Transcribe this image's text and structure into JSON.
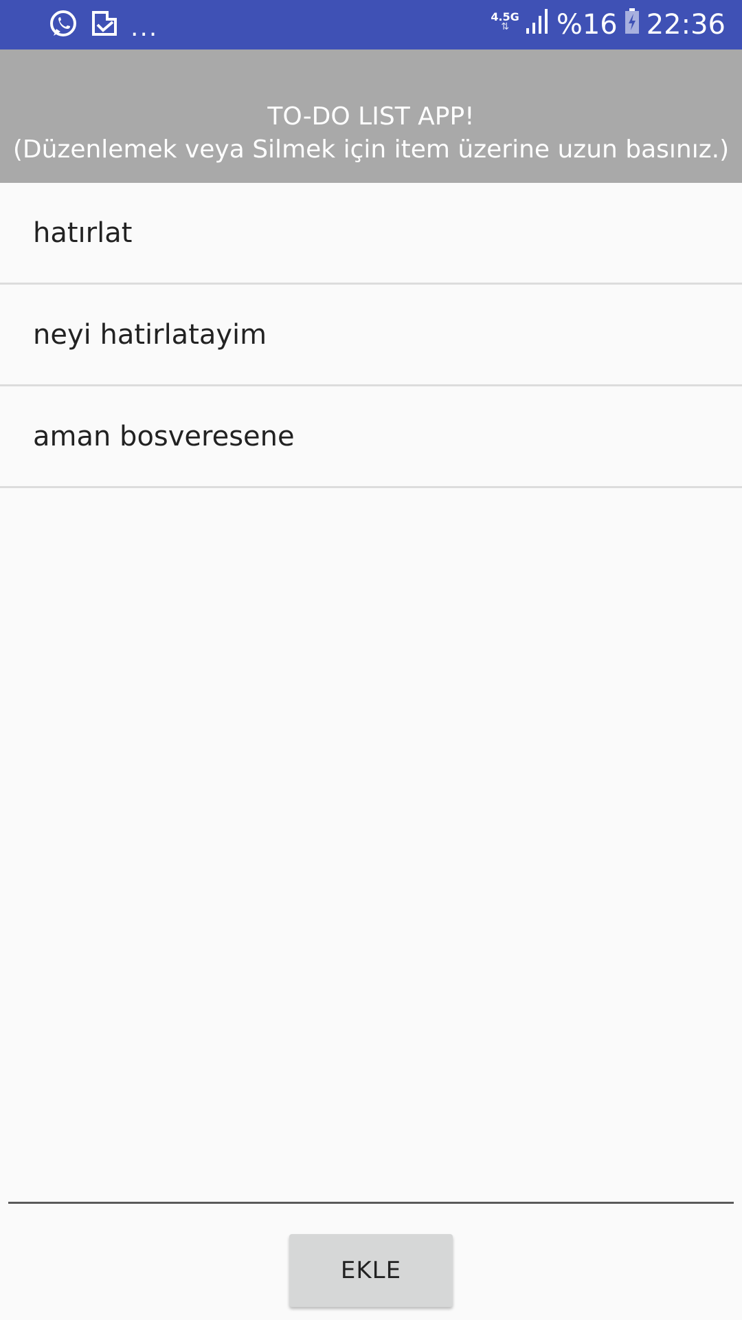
{
  "status_bar": {
    "icons_left": [
      "whatsapp-icon",
      "notification-app-icon"
    ],
    "more": "...",
    "network": "4.5G",
    "network_arrows": "⇅",
    "battery_percent": "%16",
    "time": "22:36",
    "background_color": "#3f51b5"
  },
  "header": {
    "title": "TO-DO LIST APP!",
    "subtitle": "(Düzenlemek veya Silmek için item üzerine uzun basınız.)",
    "background_color": "#a9a9a9"
  },
  "todo_list": {
    "items": [
      {
        "label": "hatırlat"
      },
      {
        "label": "neyi hatirlatayim"
      },
      {
        "label": "aman bosveresene"
      }
    ]
  },
  "actions": {
    "add_label": "EKLE"
  }
}
